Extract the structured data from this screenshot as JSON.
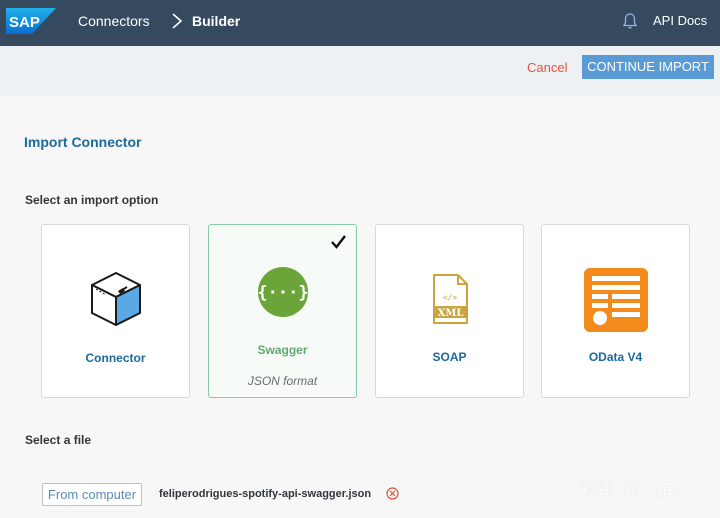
{
  "topbar": {
    "logo_text": "SAP",
    "nav_connectors": "Connectors",
    "nav_builder": "Builder",
    "api_docs": "API Docs"
  },
  "actions": {
    "cancel": "Cancel",
    "continue": "CONTINUE IMPORT"
  },
  "page": {
    "title": "Import Connector",
    "import_option_label": "Select an import option",
    "file_label": "Select a file"
  },
  "options": [
    {
      "label": "Connector",
      "icon": "cube-icon",
      "selected": false
    },
    {
      "label": "Swagger",
      "sub": "JSON format",
      "icon": "swagger-icon",
      "selected": true
    },
    {
      "label": "SOAP",
      "icon": "xml-file-icon",
      "selected": false
    },
    {
      "label": "OData V4",
      "icon": "odata-icon",
      "selected": false
    }
  ],
  "file": {
    "button_label": "From computer",
    "file_name": "feliperodrigues-spotify-api-swagger.json"
  },
  "watermark": "知乎 @PAFA",
  "colors": {
    "header_bg": "#354a5f",
    "primary_button": "#5b9bd5",
    "cancel": "#e5533d",
    "title_blue": "#1c6a9a",
    "swagger_green": "#6ba539",
    "soap_gold": "#c9a43f",
    "odata_orange": "#f28b1c"
  }
}
